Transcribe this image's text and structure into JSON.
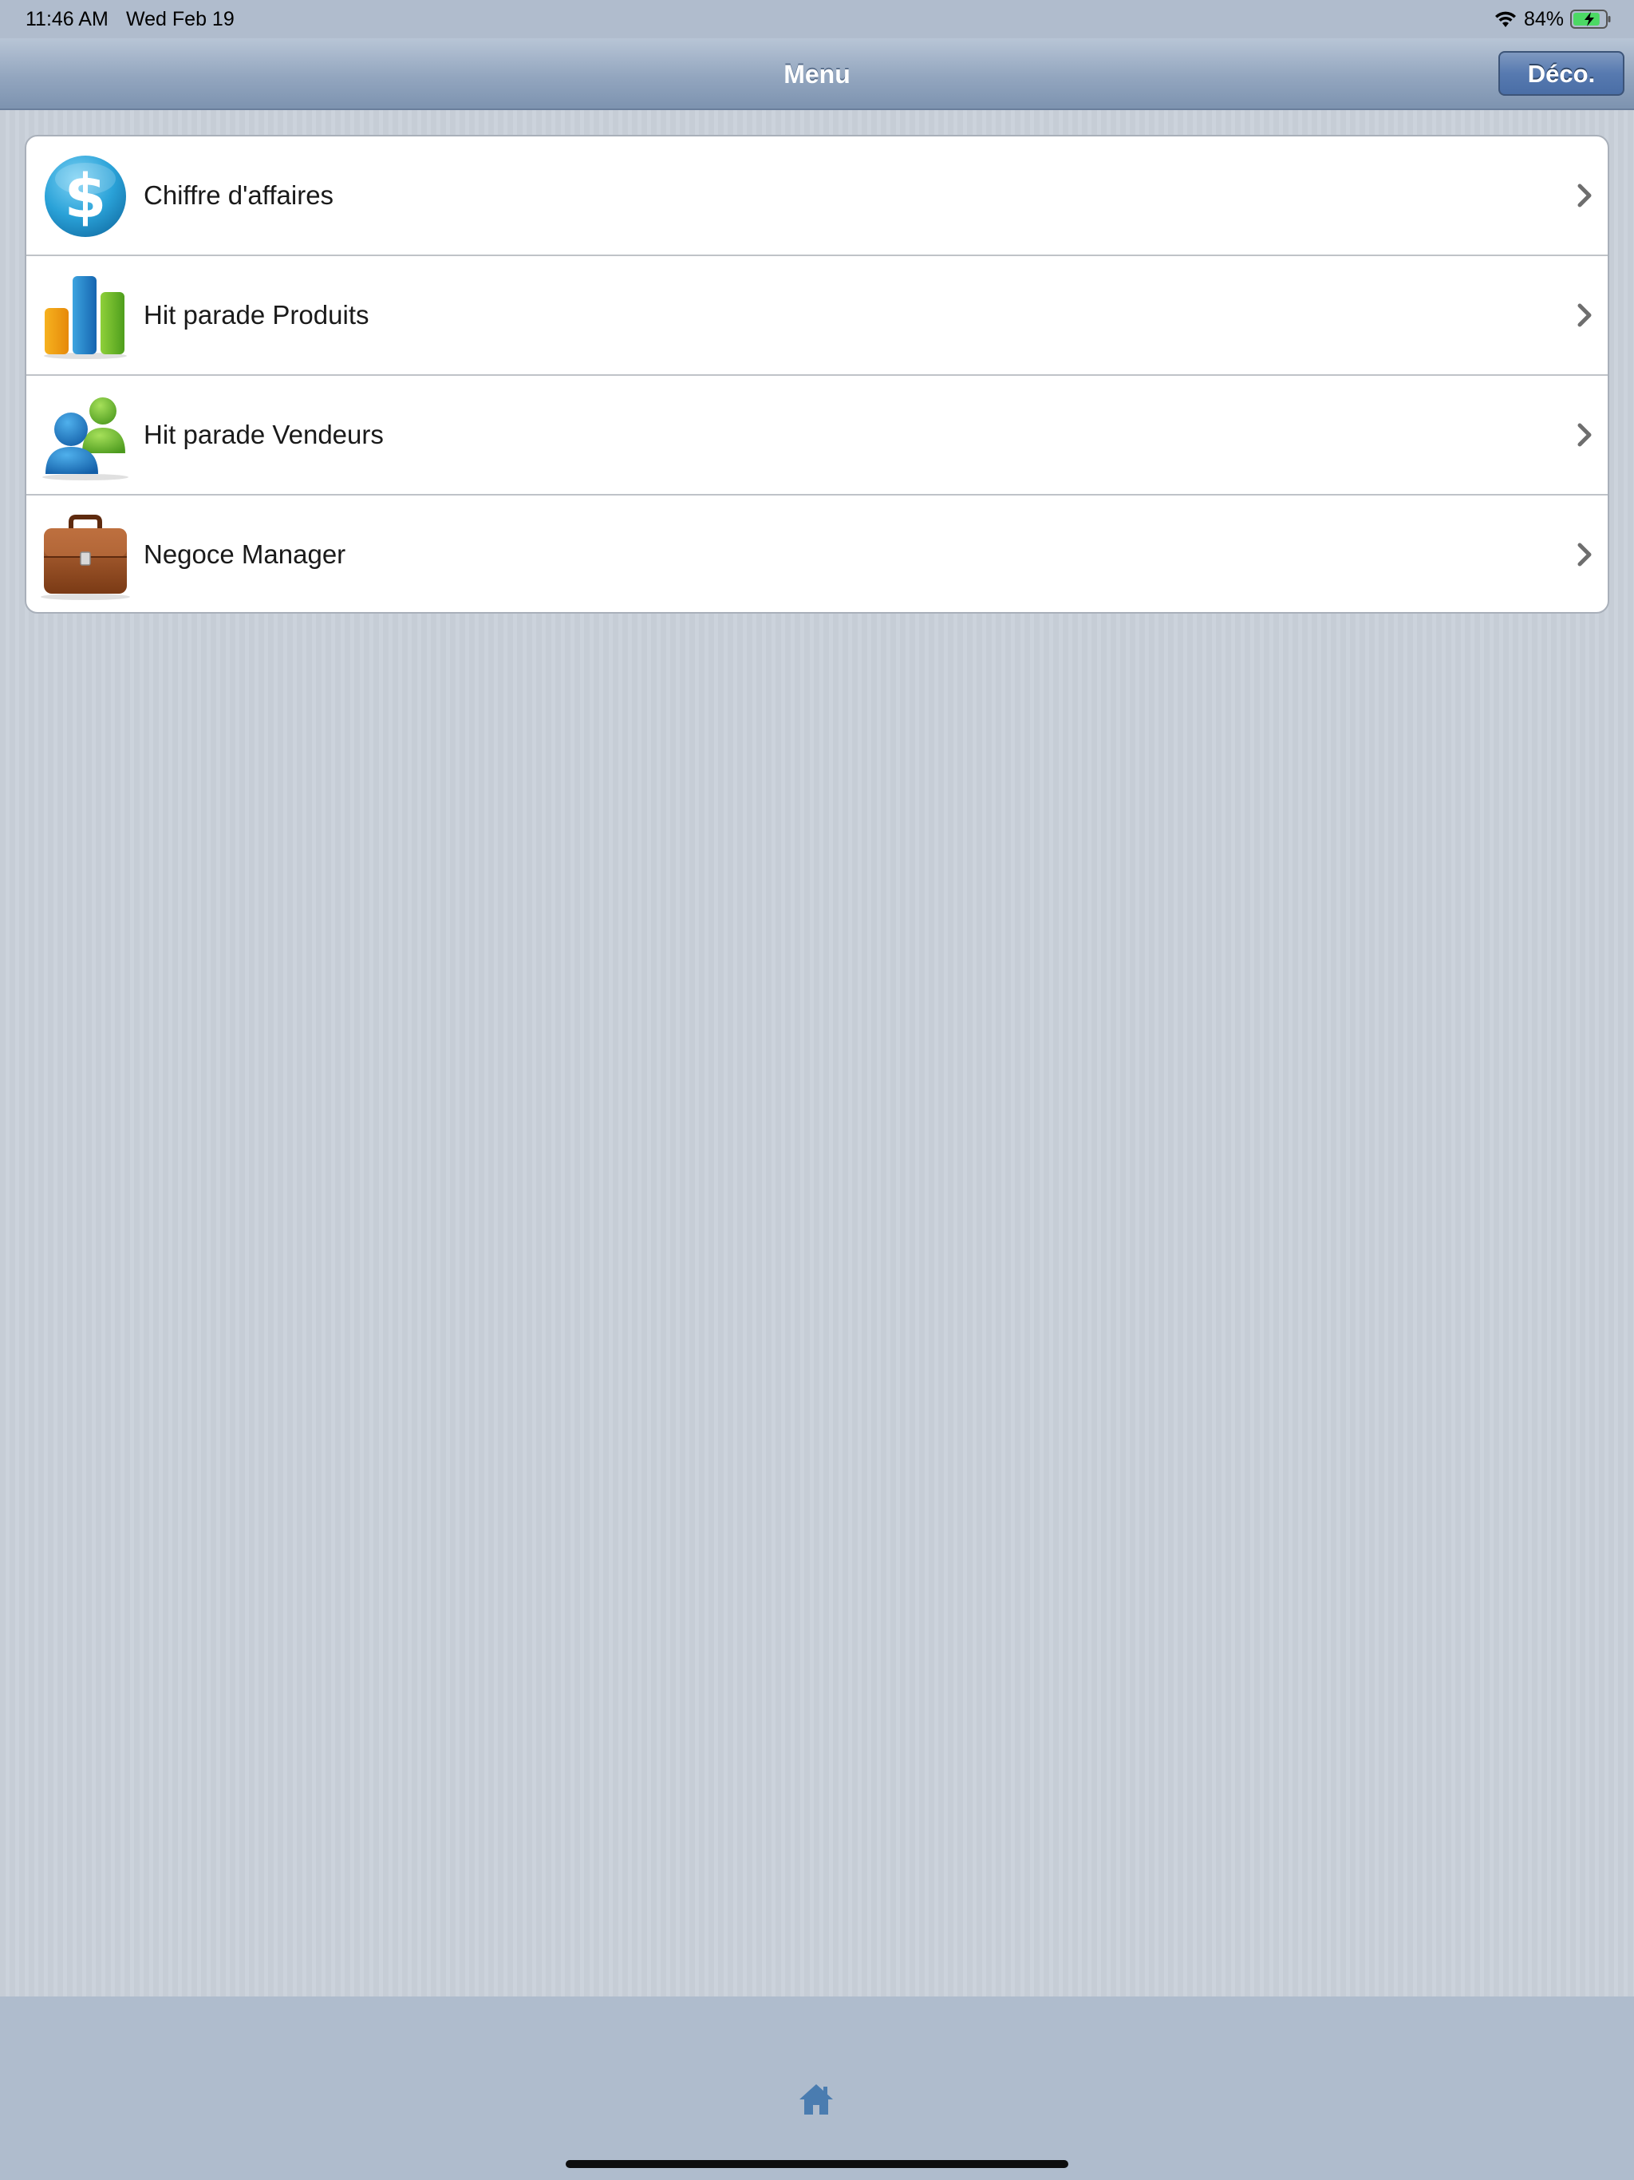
{
  "status_bar": {
    "time": "11:46 AM",
    "date": "Wed Feb 19",
    "battery_percent": "84%",
    "battery_level": 0.84,
    "wifi_icon": "wifi-icon",
    "battery_icon": "battery-charging-icon"
  },
  "nav": {
    "title": "Menu",
    "logout_label": "Déco."
  },
  "menu": {
    "items": [
      {
        "label": "Chiffre d'affaires",
        "icon": "dollar-coin-icon"
      },
      {
        "label": "Hit parade Produits",
        "icon": "bar-chart-icon"
      },
      {
        "label": "Hit parade Vendeurs",
        "icon": "users-icon"
      },
      {
        "label": "Negoce Manager",
        "icon": "briefcase-icon"
      }
    ]
  },
  "bottom_bar": {
    "home_icon": "home-icon"
  },
  "colors": {
    "nav_gradient_top": "#b8c5d6",
    "nav_gradient_bottom": "#7d93b0",
    "logout_button": "#577ab0",
    "background": "#c8cfd8",
    "bottom_bar": "#afbccd",
    "home_icon": "#4a7cb0"
  }
}
